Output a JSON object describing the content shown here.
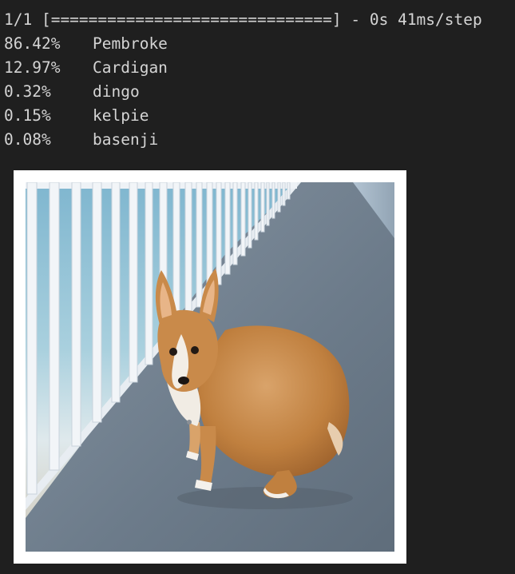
{
  "console": {
    "progress": "1/1 [==============================] - 0s 41ms/step",
    "predictions": [
      {
        "percent": "86.42%",
        "label": "Pembroke"
      },
      {
        "percent": "12.97%",
        "label": "Cardigan"
      },
      {
        "percent": "0.32%",
        "label": "dingo"
      },
      {
        "percent": "0.15%",
        "label": "kelpie"
      },
      {
        "percent": "0.08%",
        "label": "basenji"
      }
    ]
  },
  "colors": {
    "background": "#1f1f1f",
    "text": "#d4d4d4",
    "figure_border": "#ffffff",
    "walkway": "#6f7f8e",
    "railing": "#f2f5f8",
    "dog_fur": "#c98a4a"
  }
}
